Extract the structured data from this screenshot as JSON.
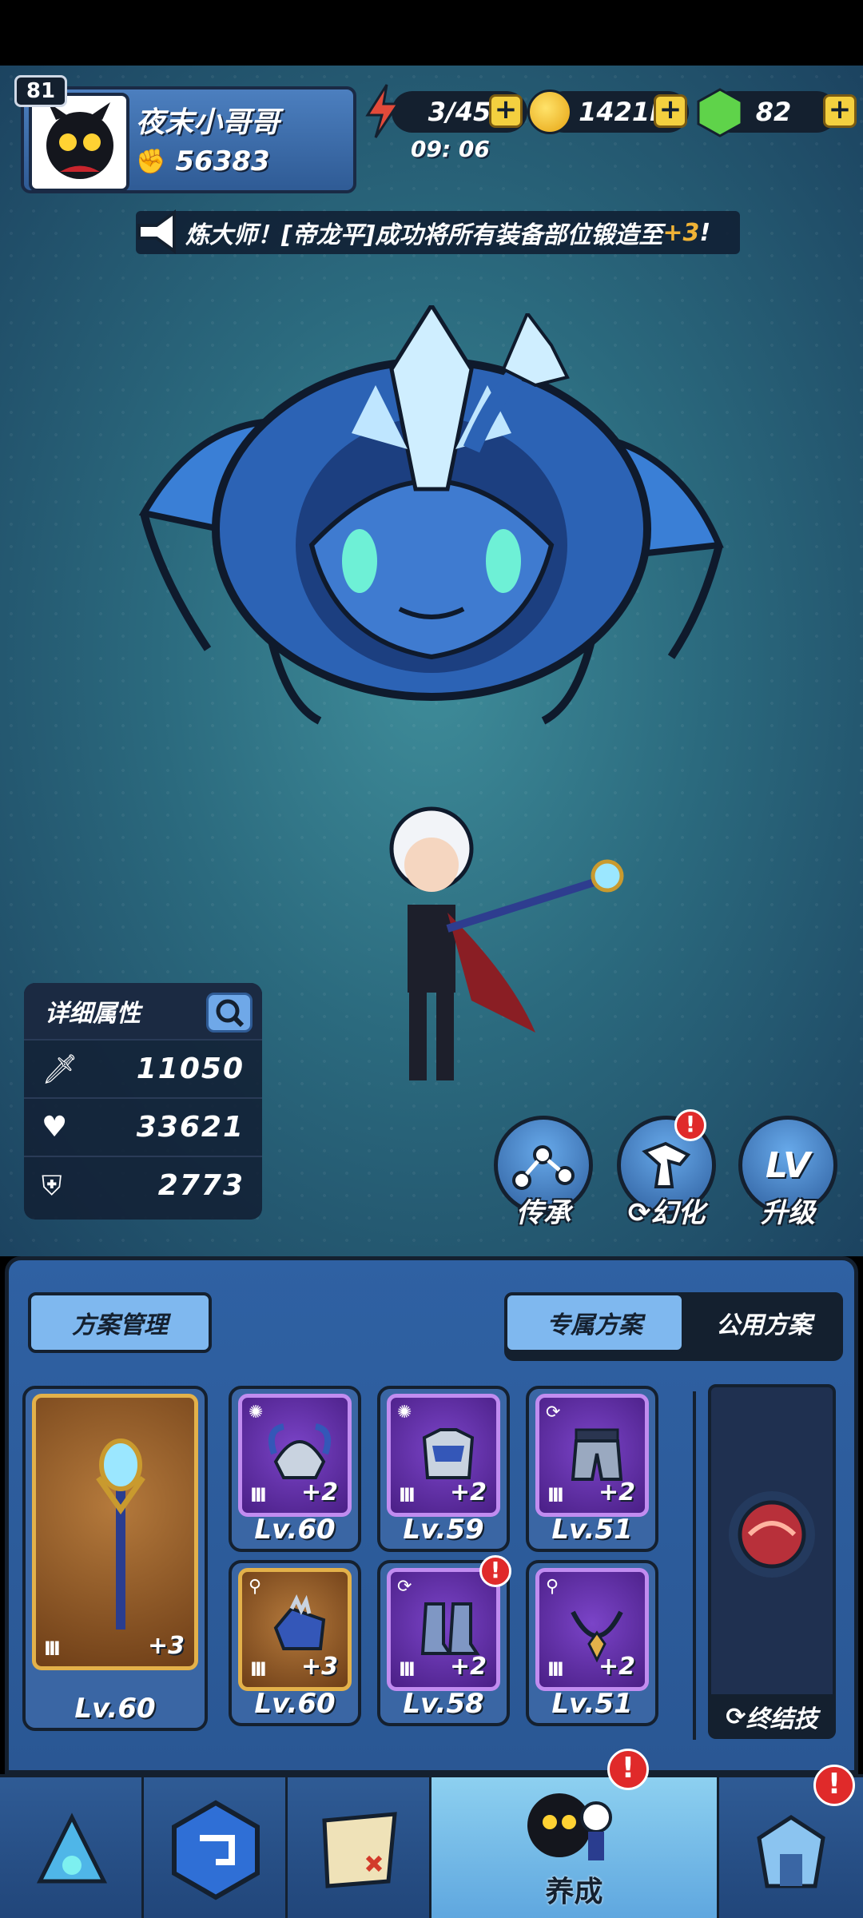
{
  "player": {
    "level": "81",
    "name": "夜末小哥哥",
    "power": "56383"
  },
  "resources": {
    "energy": "3/45",
    "energy_timer": "09: 06",
    "gold": "1421K",
    "gems": "82",
    "plus": "+"
  },
  "announcement": {
    "text": "炼大师！[帝龙平]成功将所有装备部位锻造至",
    "highlight": "+3",
    "end": "!"
  },
  "stats": {
    "title": "详细属性",
    "attack": "11050",
    "hp": "33621",
    "defense": "2773"
  },
  "actions": {
    "inherit": "传承",
    "transform": "幻化",
    "upgrade": "升级",
    "lv_glyph": "LV"
  },
  "panel": {
    "manage": "方案管理",
    "exclusive": "专属方案",
    "public": "公用方案"
  },
  "equipment": {
    "weapon": {
      "plus": "+3",
      "level": "Lv.60",
      "bars": "III"
    },
    "slots": [
      {
        "plus": "+2",
        "level": "Lv.60",
        "bars": "III"
      },
      {
        "plus": "+2",
        "level": "Lv.59",
        "bars": "III"
      },
      {
        "plus": "+2",
        "level": "Lv.51",
        "bars": "III"
      },
      {
        "plus": "+3",
        "level": "Lv.60",
        "bars": "III"
      },
      {
        "plus": "+2",
        "level": "Lv.58",
        "bars": "III"
      },
      {
        "plus": "+2",
        "level": "Lv.51",
        "bars": "III"
      }
    ]
  },
  "ultimate": {
    "label": "终结技"
  },
  "nav": {
    "develop": "养成",
    "alert": "!"
  },
  "colors": {
    "accent_blue": "#2f61a3",
    "alert_red": "#e02a2a",
    "gold": "#f4d03f",
    "dark": "#14202f"
  }
}
